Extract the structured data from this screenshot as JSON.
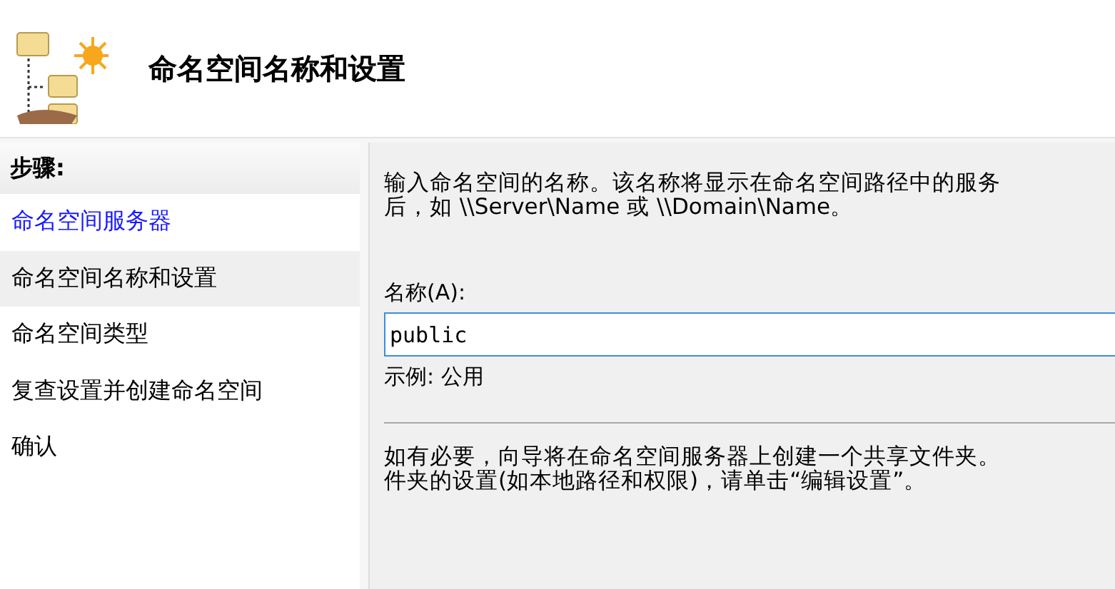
{
  "header": {
    "title": "命名空间名称和设置"
  },
  "steps": {
    "heading": "步骤:",
    "items": [
      {
        "label": "命名空间服务器",
        "completed": true,
        "selected": false
      },
      {
        "label": "命名空间名称和设置",
        "completed": false,
        "selected": true
      },
      {
        "label": "命名空间类型",
        "completed": false,
        "selected": false
      },
      {
        "label": "复查设置并创建命名空间",
        "completed": false,
        "selected": false
      },
      {
        "label": "确认",
        "completed": false,
        "selected": false
      }
    ]
  },
  "content": {
    "intro_lines": [
      "输入命名空间的名称。该名称将显示在命名空间路径中的服务",
      "后，如 \\\\Server\\Name 或 \\\\Domain\\Name。"
    ],
    "name_label": "名称(A):",
    "name_value": "public",
    "example": "示例: 公用",
    "note_lines": [
      "如有必要，向导将在命名空间服务器上创建一个共享文件夹。",
      "件夹的设置(如本地路径和权限)，请单击“编辑设置”。"
    ]
  }
}
